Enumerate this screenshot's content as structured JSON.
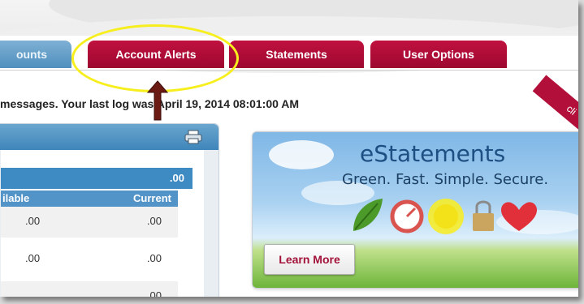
{
  "nav": {
    "tabs": [
      {
        "label": "ounts",
        "active": true
      },
      {
        "label": "Account Alerts",
        "active": false
      },
      {
        "label": "Statements",
        "active": false
      },
      {
        "label": "User Options",
        "active": false
      }
    ]
  },
  "login_message": "messages. Your last log  was April 19, 2014 08:01:00 AM",
  "accounts": {
    "print_icon": "printer-icon",
    "total_value": ".00",
    "columns": {
      "available": "ilable",
      "current": "Current"
    },
    "rows": [
      {
        "available": ".00",
        "current": ".00"
      },
      {
        "available": ".00",
        "current": ".00"
      },
      {
        "available": "",
        "current": ".00"
      }
    ]
  },
  "banner": {
    "title": "eStatements",
    "subtitle": "Green. Fast. Simple. Secure.",
    "button": "Learn More",
    "ribbon": "cli",
    "icons": [
      "leaf-icon",
      "gauge-icon",
      "sun-icon",
      "lock-icon",
      "heart-icon"
    ]
  },
  "colors": {
    "tab_red": "#b20d3a",
    "tab_blue": "#5e9ac6",
    "panel_blue": "#3e8ac3",
    "annotation": "#f7ef1d",
    "arrow": "#6b1a14"
  }
}
